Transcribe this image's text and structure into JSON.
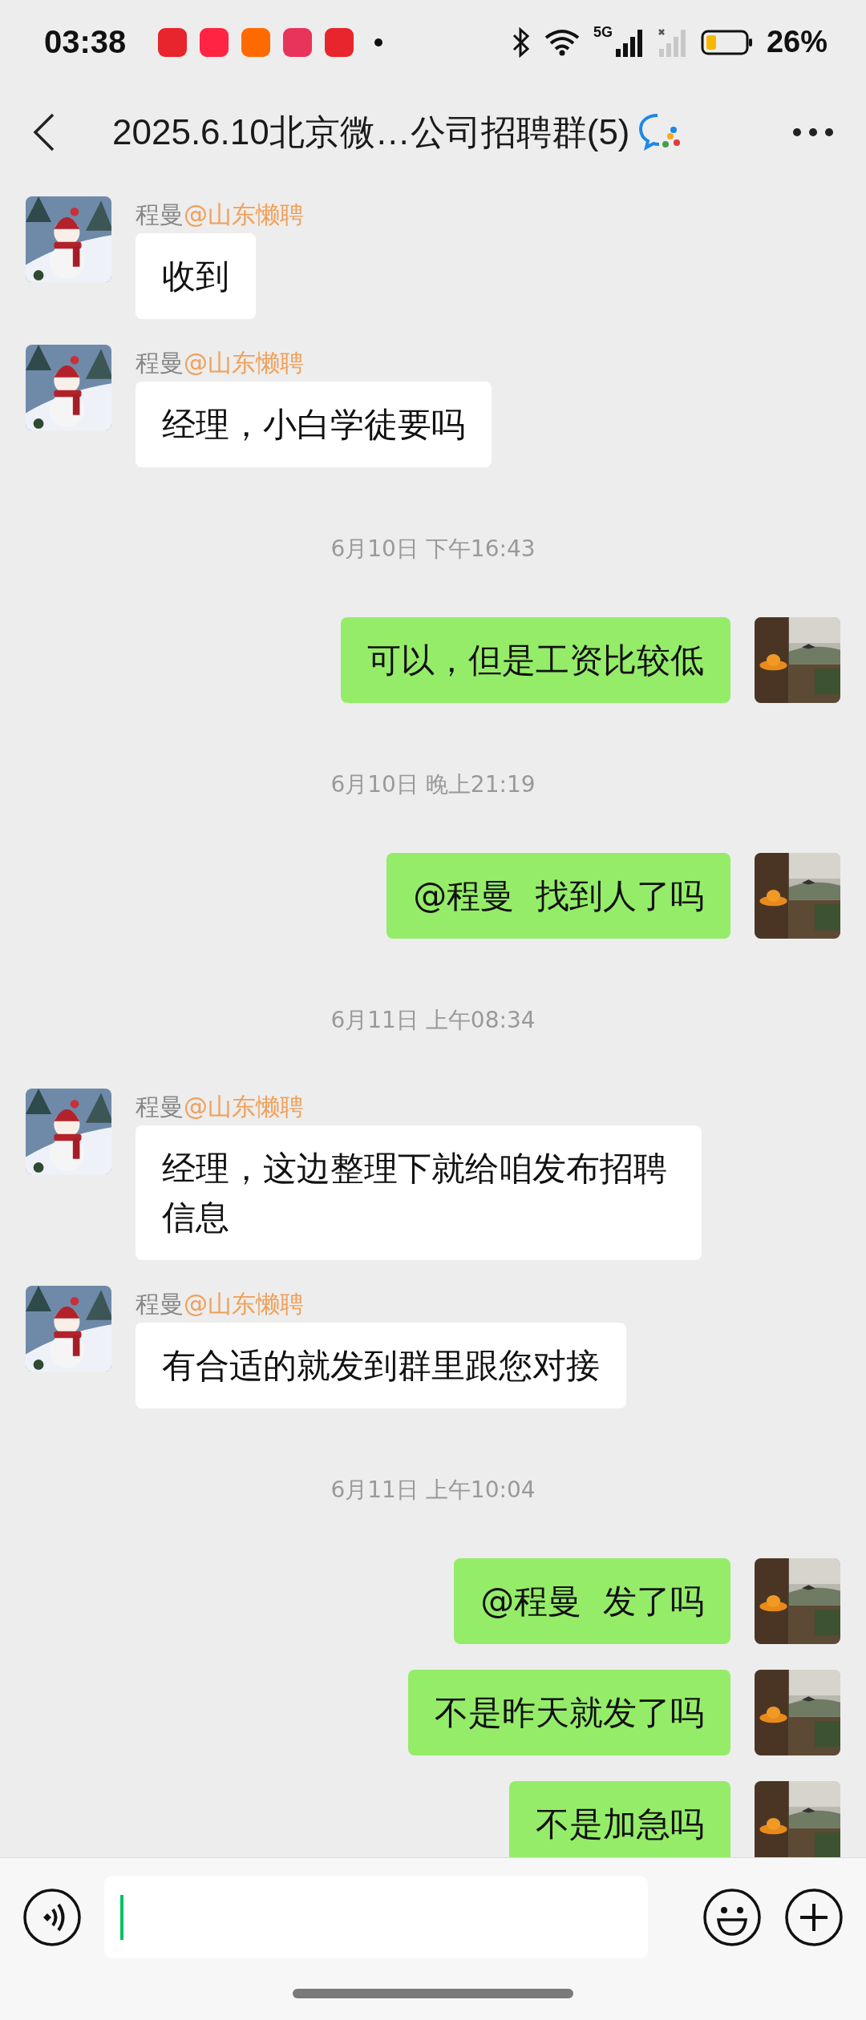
{
  "status_bar": {
    "time": "03:38",
    "network": "5G",
    "battery": "26%"
  },
  "header": {
    "title": "2025.6.10北京微…公司招聘群(5)"
  },
  "messages": [
    {
      "kind": "incoming",
      "sender": "程曼",
      "group": "@山东懒聘",
      "text": "收到"
    },
    {
      "kind": "incoming",
      "sender": "程曼",
      "group": "@山东懒聘",
      "text": "经理，小白学徒要吗"
    },
    {
      "kind": "timestamp",
      "text": "6月10日 下午16:43"
    },
    {
      "kind": "outgoing",
      "text": "可以，但是工资比较低"
    },
    {
      "kind": "timestamp",
      "text": "6月10日 晚上21:19"
    },
    {
      "kind": "outgoing",
      "text": "@程曼  找到人了吗"
    },
    {
      "kind": "timestamp",
      "text": "6月11日 上午08:34"
    },
    {
      "kind": "incoming",
      "sender": "程曼",
      "group": "@山东懒聘",
      "text": "经理，这边整理下就给咱发布招聘信息"
    },
    {
      "kind": "incoming",
      "sender": "程曼",
      "group": "@山东懒聘",
      "text": "有合适的就发到群里跟您对接"
    },
    {
      "kind": "timestamp",
      "text": "6月11日 上午10:04"
    },
    {
      "kind": "outgoing",
      "text": "@程曼  发了吗"
    },
    {
      "kind": "outgoing",
      "text": "不是昨天就发了吗"
    },
    {
      "kind": "outgoing",
      "text": "不是加急吗"
    }
  ]
}
